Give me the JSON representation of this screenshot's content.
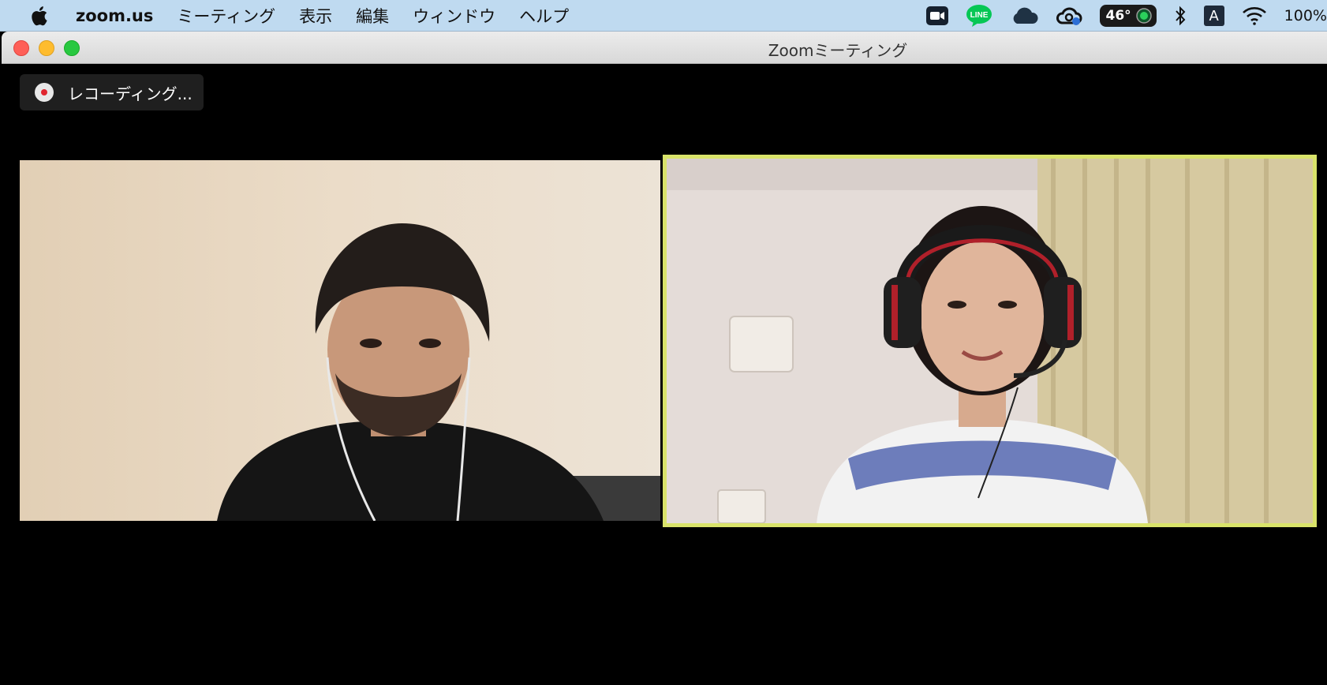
{
  "menubar": {
    "app_name": "zoom.us",
    "items": [
      "ミーティング",
      "表示",
      "編集",
      "ウィンドウ",
      "ヘルプ"
    ],
    "status": {
      "line_label": "LINE",
      "temperature": "46°",
      "keyboard_input": "A",
      "battery": "100%"
    }
  },
  "window": {
    "title": "Zoomミーティング"
  },
  "meeting": {
    "recording_label": "レコーディング...",
    "active_speaker_border_color": "#d9e36a"
  }
}
